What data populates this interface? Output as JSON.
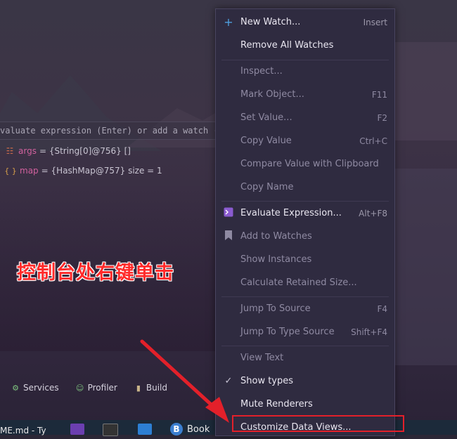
{
  "debugger": {
    "eval_placeholder": "valuate expression (Enter) or add a watch (C",
    "variables": [
      {
        "name": "args",
        "value": "= {String[0]@756} []"
      },
      {
        "name": "map",
        "value": "= {HashMap@757}  size = 1"
      }
    ],
    "map_icon_text": "{ }"
  },
  "annotation": "控制台处右键单击",
  "tool_tabs": [
    {
      "label": "Services"
    },
    {
      "label": "Profiler"
    },
    {
      "label": "Build"
    }
  ],
  "taskbar": {
    "left_text": "ME.md - Ty",
    "book_label": "Book",
    "book_letter": "B"
  },
  "menu": {
    "items": [
      {
        "label": "New Watch...",
        "shortcut": "Insert",
        "icon": "+"
      },
      {
        "label": "Remove All Watches",
        "shortcut": "",
        "icon": ""
      },
      {
        "label": "Inspect...",
        "shortcut": "",
        "icon": ""
      },
      {
        "label": "Mark Object...",
        "shortcut": "F11",
        "icon": ""
      },
      {
        "label": "Set Value...",
        "shortcut": "F2",
        "icon": ""
      },
      {
        "label": "Copy Value",
        "shortcut": "Ctrl+C",
        "icon": ""
      },
      {
        "label": "Compare Value with Clipboard",
        "shortcut": "",
        "icon": ""
      },
      {
        "label": "Copy Name",
        "shortcut": "",
        "icon": ""
      },
      {
        "label": "Evaluate Expression...",
        "shortcut": "Alt+F8",
        "icon": ""
      },
      {
        "label": "Add to Watches",
        "shortcut": "",
        "icon": ""
      },
      {
        "label": "Show Instances",
        "shortcut": "",
        "icon": ""
      },
      {
        "label": "Calculate Retained Size...",
        "shortcut": "",
        "icon": ""
      },
      {
        "label": "Jump To Source",
        "shortcut": "F4",
        "icon": ""
      },
      {
        "label": "Jump To Type Source",
        "shortcut": "Shift+F4",
        "icon": ""
      },
      {
        "label": "View Text",
        "shortcut": "",
        "icon": ""
      },
      {
        "label": "Show types",
        "shortcut": "",
        "icon": "✓"
      },
      {
        "label": "Mute Renderers",
        "shortcut": "",
        "icon": ""
      },
      {
        "label": "Customize Data Views...",
        "shortcut": "",
        "icon": ""
      }
    ]
  }
}
